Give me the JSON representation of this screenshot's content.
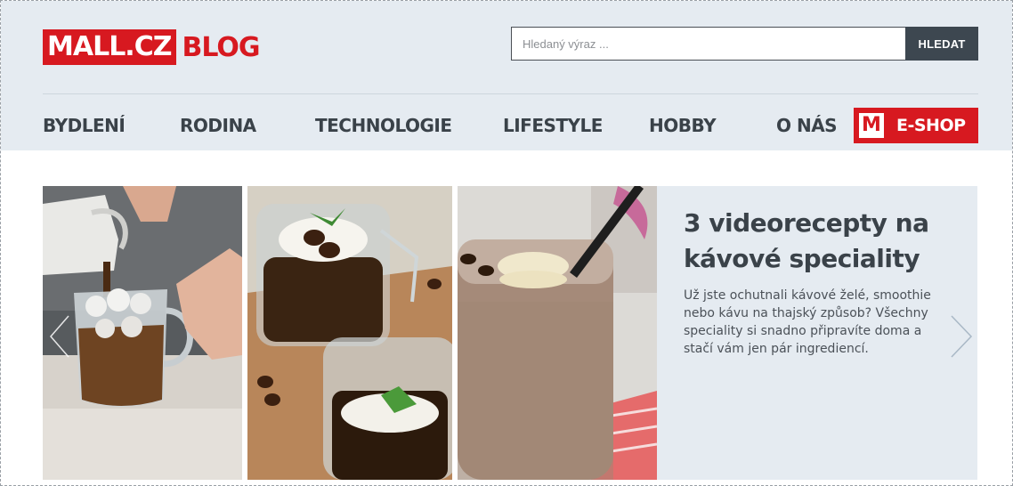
{
  "header": {
    "logo_main": "MALL.CZ",
    "logo_sub": "BLOG",
    "search_placeholder": "Hledaný výraz ...",
    "search_button": "HLEDAT"
  },
  "nav": {
    "items": [
      "BYDLENÍ",
      "RODINA",
      "TECHNOLOGIE",
      "LIFESTYLE",
      "HOBBY",
      "O NÁS"
    ],
    "eshop_icon": "M",
    "eshop_label": "E-SHOP"
  },
  "slide": {
    "title": "3 videorecepty na kávové speciality",
    "description": "Už jste ochutnali kávové želé, smoothie nebo kávu na thajský způsob? Všechny speciality si snadno připravíte doma a stačí vám jen pár ingrediencí."
  },
  "colors": {
    "brand_red": "#d71920",
    "header_bg": "#e5ebf1",
    "nav_text": "#3a4249",
    "search_button_bg": "#3d4750"
  },
  "icons": {
    "prev": "chevron-left-icon",
    "next": "chevron-right-icon"
  }
}
